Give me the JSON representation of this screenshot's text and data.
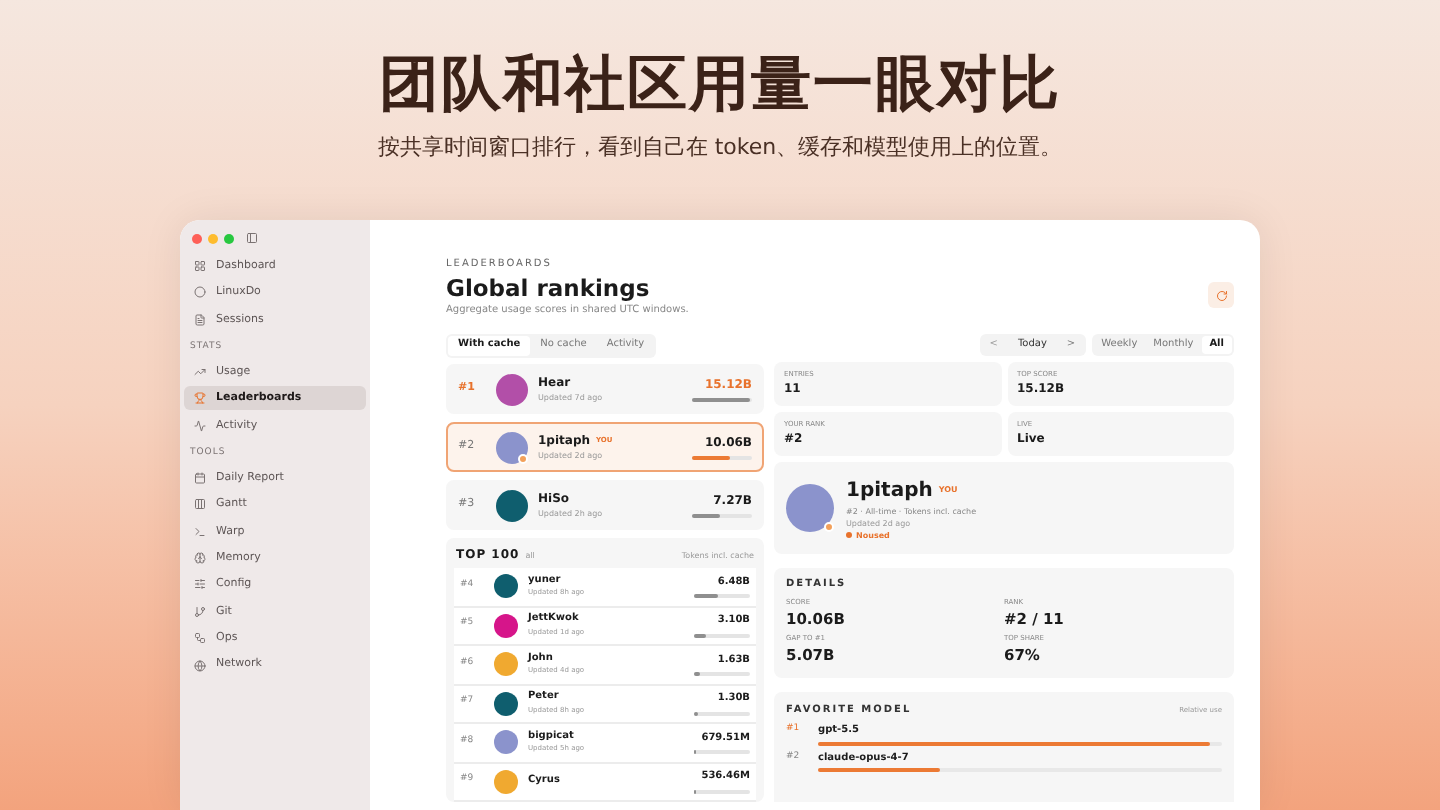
{
  "headline": "团队和社区用量一眼对比",
  "subtitle": "按共享时间窗口排行，看到自己在 token、缓存和模型使用上的位置。",
  "sidebar": {
    "items": [
      {
        "label": "Dashboard",
        "selected": false
      },
      {
        "label": "LinuxDo",
        "selected": false
      },
      {
        "label": "Sessions",
        "selected": false
      }
    ],
    "sections": [
      {
        "title": "STATS",
        "items": [
          {
            "label": "Usage",
            "selected": false
          },
          {
            "label": "Leaderboards",
            "selected": true
          },
          {
            "label": "Activity",
            "selected": false
          }
        ]
      },
      {
        "title": "TOOLS",
        "items": [
          {
            "label": "Daily Report",
            "selected": false
          },
          {
            "label": "Gantt",
            "selected": false
          },
          {
            "label": "Warp",
            "selected": false
          },
          {
            "label": "Memory",
            "selected": false
          },
          {
            "label": "Config",
            "selected": false
          },
          {
            "label": "Git",
            "selected": false
          },
          {
            "label": "Ops",
            "selected": false
          },
          {
            "label": "Network",
            "selected": false
          }
        ]
      }
    ]
  },
  "header": {
    "eyebrow": "LEADERBOARDS",
    "title": "Global rankings",
    "description": "Aggregate usage scores in shared UTC windows."
  },
  "tabs": [
    {
      "label": "With cache",
      "selected": true
    },
    {
      "label": "No cache",
      "selected": false
    },
    {
      "label": "Activity",
      "selected": false
    }
  ],
  "period": {
    "prev": "<",
    "label": "Today",
    "next": ">"
  },
  "ranges": [
    {
      "label": "Weekly",
      "selected": false
    },
    {
      "label": "Monthly",
      "selected": false
    },
    {
      "label": "All",
      "selected": true
    }
  ],
  "podium": [
    {
      "rank": "#1",
      "name": "Hear",
      "updated": "Updated 7d ago",
      "value": "15.12B",
      "level": 0.95,
      "top": true,
      "selected": false,
      "color": "#b24fa8"
    },
    {
      "rank": "#2",
      "name": "1pitaph",
      "updated": "Updated 2d ago",
      "value": "10.06B",
      "level": 0.64,
      "top": false,
      "selected": true,
      "you": "YOU",
      "color": "#8b93cc"
    },
    {
      "rank": "#3",
      "name": "HiSo",
      "updated": "Updated 2h ago",
      "value": "7.27B",
      "level": 0.46,
      "top": false,
      "selected": false,
      "color": "#0f5e6e"
    }
  ],
  "top100": {
    "title": "TOP 100",
    "scope": "all",
    "note": "Tokens incl. cache",
    "rows": [
      {
        "rank": "#4",
        "name": "yuner",
        "updated": "Updated 8h ago",
        "value": "6.48B",
        "level": 0.43,
        "color": "#0f5e6e"
      },
      {
        "rank": "#5",
        "name": "JettKwok",
        "updated": "Updated 1d ago",
        "value": "3.10B",
        "level": 0.2,
        "color": "#d6158a"
      },
      {
        "rank": "#6",
        "name": "John",
        "updated": "Updated 4d ago",
        "value": "1.63B",
        "level": 0.1,
        "color": "#f0a930"
      },
      {
        "rank": "#7",
        "name": "Peter",
        "updated": "Updated 8h ago",
        "value": "1.30B",
        "level": 0.08,
        "color": "#0f5e6e"
      },
      {
        "rank": "#8",
        "name": "bigpicat",
        "updated": "Updated 5h ago",
        "value": "679.51M",
        "level": 0.045,
        "color": "#8b93cc"
      },
      {
        "rank": "#9",
        "name": "Cyrus",
        "updated": "",
        "value": "536.46M",
        "level": 0.035,
        "color": "#f0a930"
      }
    ]
  },
  "stats": [
    {
      "label": "ENTRIES",
      "value": "11"
    },
    {
      "label": "TOP SCORE",
      "value": "15.12B"
    },
    {
      "label": "YOUR RANK",
      "value": "#2"
    },
    {
      "label": "LIVE",
      "value": "Live"
    }
  ],
  "profile": {
    "name": "1pitaph",
    "badge": "YOU",
    "meta": "#2 · All-time · Tokens incl. cache",
    "updated": "Updated 2d ago",
    "status": "Noused",
    "color": "#8b93cc"
  },
  "details": {
    "title": "DETAILS",
    "items": [
      {
        "label": "SCORE",
        "value": "10.06B"
      },
      {
        "label": "RANK",
        "value": "#2 / 11"
      },
      {
        "label": "GAP TO #1",
        "value": "5.07B"
      },
      {
        "label": "TOP SHARE",
        "value": "67%"
      }
    ]
  },
  "favorite_model": {
    "title": "FAVORITE MODEL",
    "note": "Relative use",
    "rows": [
      {
        "rank": "#1",
        "name": "gpt-5.5",
        "level": 0.97
      },
      {
        "rank": "#2",
        "name": "claude-opus-4-7",
        "level": 0.3
      }
    ]
  }
}
